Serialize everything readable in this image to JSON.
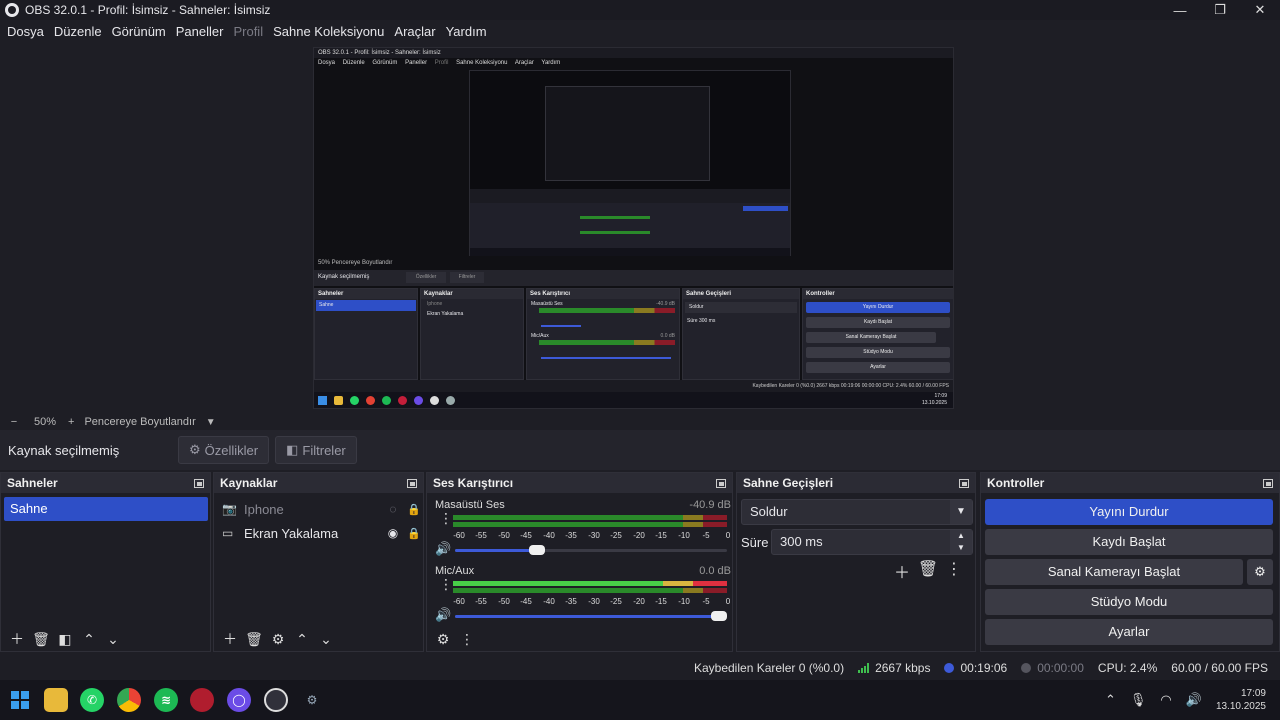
{
  "window": {
    "title": "OBS 32.0.1 - Profil: İsimsiz - Sahneler: İsimsiz"
  },
  "menu": [
    {
      "label": "Dosya",
      "disabled": false
    },
    {
      "label": "Düzenle",
      "disabled": false
    },
    {
      "label": "Görünüm",
      "disabled": false
    },
    {
      "label": "Paneller",
      "disabled": false
    },
    {
      "label": "Profil",
      "disabled": true
    },
    {
      "label": "Sahne Koleksiyonu",
      "disabled": false
    },
    {
      "label": "Araçlar",
      "disabled": false
    },
    {
      "label": "Yardım",
      "disabled": false
    }
  ],
  "zoom": {
    "minus": "−",
    "value": "50%",
    "plus": "+",
    "fit_label": "Pencereye Boyutlandır"
  },
  "context": {
    "no_source": "Kaynak seçilmemiş",
    "properties": "Özellikler",
    "filters": "Filtreler"
  },
  "scenes": {
    "title": "Sahneler",
    "items": [
      "Sahne"
    ]
  },
  "sources": {
    "title": "Kaynaklar",
    "items": [
      {
        "name": "Iphone",
        "visible": false,
        "icon": "camera-icon"
      },
      {
        "name": "Ekran Yakalama",
        "visible": true,
        "icon": "monitor-icon"
      }
    ]
  },
  "mixer": {
    "title": "Ses Karıştırıcı",
    "ticks": [
      "-60",
      "-55",
      "-50",
      "-45",
      "-40",
      "-35",
      "-30",
      "-25",
      "-20",
      "-15",
      "-10",
      "-5",
      "0"
    ],
    "tracks": [
      {
        "name": "Masaüstü Ses",
        "db": "-40.9 dB",
        "volume": 0.3
      },
      {
        "name": "Mic/Aux",
        "db": "0.0 dB",
        "volume": 0.97
      }
    ]
  },
  "transitions": {
    "title": "Sahne Geçişleri",
    "selected": "Soldur",
    "duration_label": "Süre",
    "duration": "300 ms"
  },
  "controls": {
    "title": "Kontroller",
    "stop_stream": "Yayını Durdur",
    "start_recording": "Kaydı Başlat",
    "start_virtualcam": "Sanal Kamerayı Başlat",
    "studio_mode": "Stüdyo Modu",
    "settings": "Ayarlar"
  },
  "status": {
    "dropped_frames": "Kaybedilen Kareler 0 (%0.0)",
    "bitrate": "2667 kbps",
    "stream_time": "00:19:06",
    "record_time": "00:00:00",
    "cpu": "CPU: 2.4%",
    "fps": "60.00 / 60.00 FPS"
  },
  "taskbar": {
    "time": "17:09",
    "date": "13.10.2025"
  },
  "colors": {
    "accent": "#2e4fc7",
    "meter_green": "#2a8a2a",
    "meter_yellow": "#8a7a20",
    "meter_red": "#8a1c28",
    "slider": "#3d5ad8"
  },
  "mini": {
    "title": "OBS 32.0.1 - Profil: İsimsiz - Sahneler: İsimsiz",
    "menu": [
      "Dosya",
      "Düzenle",
      "Görünüm",
      "Paneller",
      "Profil",
      "Sahne Koleksiyonu",
      "Araçlar",
      "Yardım"
    ],
    "zoom_line": "50%   Pencereye Boyutlandır",
    "context": "Kaynak seçilmemiş",
    "properties": "Özellikler",
    "filters": "Filtreler",
    "scenes_title": "Sahneler",
    "scene": "Sahne",
    "sources_title": "Kaynaklar",
    "source1": "Iphone",
    "source2": "Ekran Yakalama",
    "mixer_title": "Ses Karıştırıcı",
    "track1": "Masaüstü Ses",
    "track1_db": "-40.9 dB",
    "track2": "Mic/Aux",
    "track2_db": "0.0 dB",
    "transitions_title": "Sahne Geçişleri",
    "transition": "Soldur",
    "duration_label": "Süre",
    "duration": "300 ms",
    "controls_title": "Kontroller",
    "stop_stream": "Yayını Durdur",
    "start_recording": "Kaydı Başlat",
    "virtualcam": "Sanal Kamerayı Başlat",
    "studio": "Stüdyo Modu",
    "settings": "Ayarlar",
    "status": "Kaybedilen Kareler 0 (%0.0)   2667 kbps   00:19:06   00:00:00   CPU: 2.4%   60.00 / 60.00 FPS",
    "time": "17:09",
    "date": "13.10.2025"
  }
}
